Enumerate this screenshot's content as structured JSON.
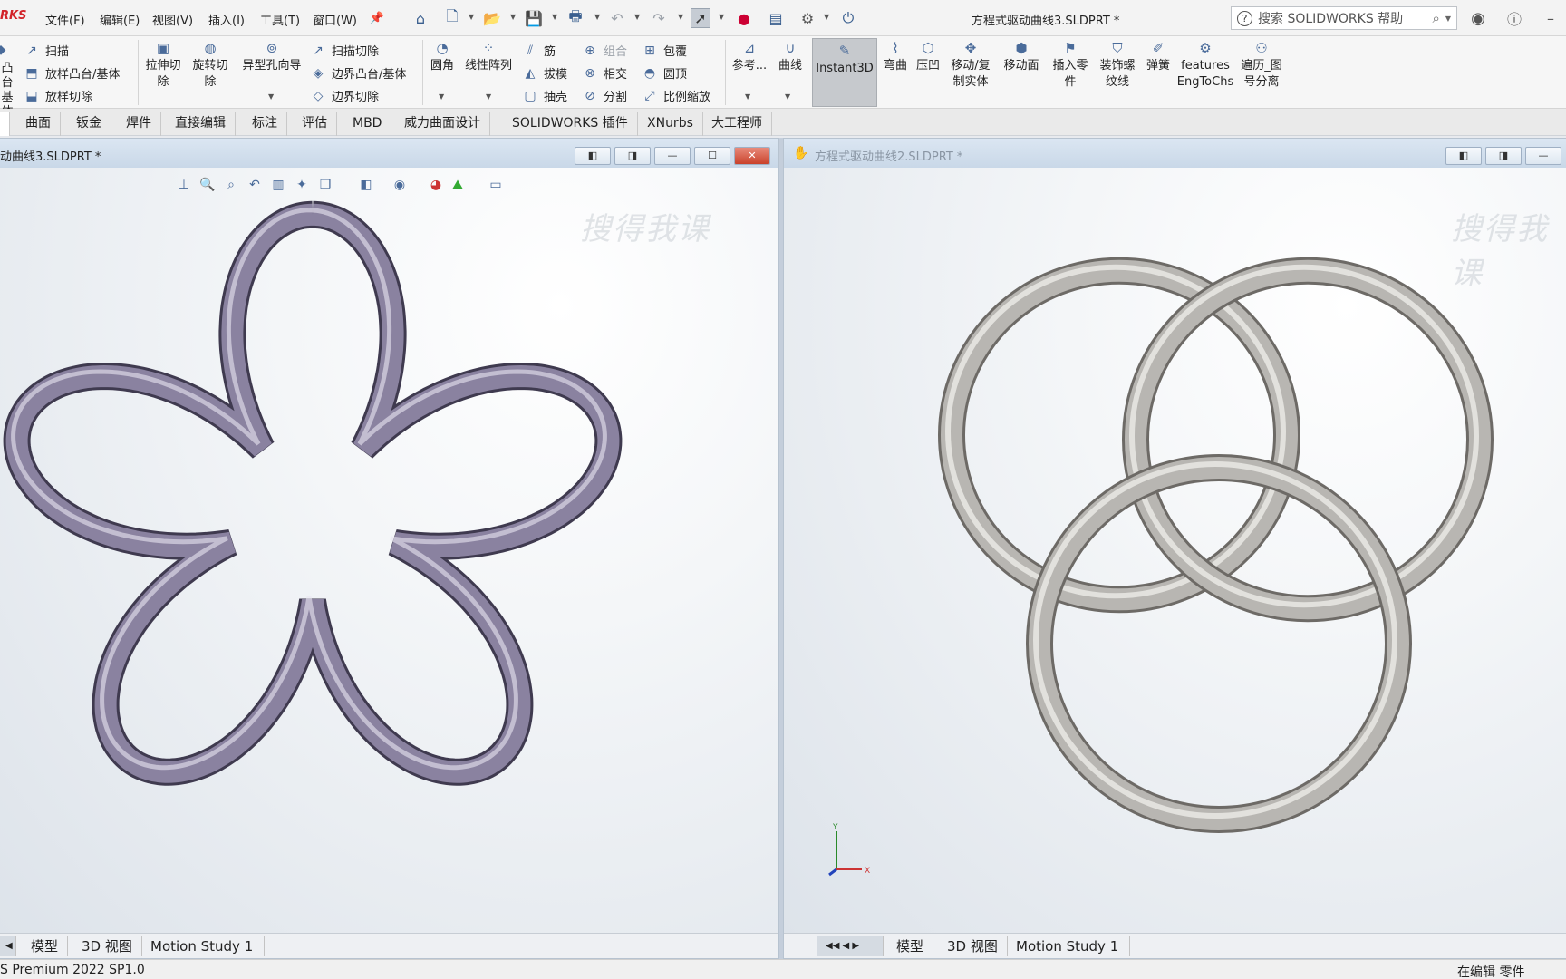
{
  "app": {
    "logo": "RKS",
    "doc_title": "方程式驱动曲线3.SLDPRT *"
  },
  "menu": [
    {
      "label": "文件(F)"
    },
    {
      "label": "编辑(E)"
    },
    {
      "label": "视图(V)"
    },
    {
      "label": "插入(I)"
    },
    {
      "label": "工具(T)"
    },
    {
      "label": "窗口(W)"
    }
  ],
  "search": {
    "placeholder": "搜索 SOLIDWORKS 帮助"
  },
  "ribbon": {
    "col1": [
      "扫描",
      "放样凸台/基体",
      "放样切除"
    ],
    "col1_left": [
      "凸台",
      "基体"
    ],
    "big1": [
      "拉伸切",
      "除"
    ],
    "big2": [
      "旋转切",
      "除"
    ],
    "big3": "异型孔向导",
    "col2": [
      "扫描切除",
      "边界凸台/基体",
      "边界切除"
    ],
    "big4": "圆角",
    "big5": "线性阵列",
    "col3": [
      "筋",
      "拔模",
      "抽壳"
    ],
    "col4": [
      "组合",
      "相交",
      "分割"
    ],
    "col5": [
      "包覆",
      "圆顶",
      "比例缩放"
    ],
    "big6": "参考...",
    "big7": "曲线",
    "instant3d": "Instant3D",
    "big8": "弯曲",
    "big9": "压凹",
    "big10": [
      "移动/复",
      "制实体"
    ],
    "big11": "移动面",
    "big12": [
      "插入零",
      "件"
    ],
    "big13": [
      "装饰螺",
      "纹线"
    ],
    "big14": "弹簧",
    "big15": [
      "features",
      "EngToChs"
    ],
    "big16": [
      "遍历_图",
      "号分离"
    ]
  },
  "tabs": [
    "",
    "曲面",
    "钣金",
    "焊件",
    "直接编辑",
    "标注",
    "评估",
    "MBD",
    "威力曲面设计",
    "SOLIDWORKS 插件",
    "XNurbs",
    "大工程师"
  ],
  "viewport1": {
    "title": "动曲线3.SLDPRT *",
    "watermark": "搜得我课",
    "bottom_tabs": [
      "模型",
      "3D 视图",
      "Motion Study 1"
    ],
    "model_color": "#8a82a0"
  },
  "viewport2": {
    "title": "方程式驱动曲线2.SLDPRT *",
    "watermark": "搜得我课",
    "bottom_tabs": [
      "模型",
      "3D 视图",
      "Motion Study 1"
    ],
    "model_color": "#b8b6b2",
    "axis_y": "Y",
    "axis_x": "X"
  },
  "status": {
    "left": "S Premium 2022 SP1.0",
    "right": "在编辑 零件"
  },
  "window_buttons": {
    "close": "✕"
  }
}
